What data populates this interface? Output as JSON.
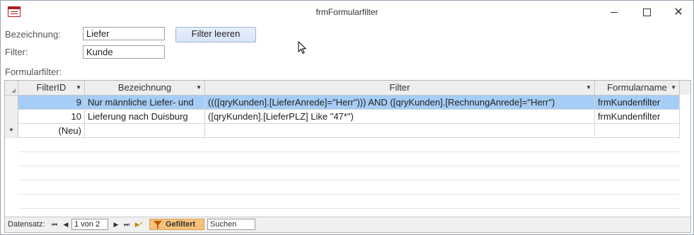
{
  "window": {
    "title": "frmFormularfilter"
  },
  "form": {
    "bezeichnung_label": "Bezeichnung:",
    "bezeichnung_value": "Liefer",
    "filter_label": "Filter:",
    "filter_value": "Kunde",
    "clear_button": "Filter leeren",
    "subform_label": "Formularfilter:"
  },
  "grid": {
    "columns": [
      "FilterID",
      "Bezeichnung",
      "Filter",
      "Formularname"
    ],
    "rows": [
      {
        "id": "9",
        "bezeichnung": "Nur männliche Liefer- und",
        "filter": "((([qryKunden].[LieferAnrede]=\"Herr\"))) AND ([qryKunden].[RechnungAnrede]=\"Herr\")",
        "formularname": "frmKundenfilter"
      },
      {
        "id": "10",
        "bezeichnung": "Lieferung nach Duisburg",
        "filter": "([qryKunden].[LieferPLZ] Like \"47*\")",
        "formularname": "frmKundenfilter"
      }
    ],
    "new_row_marker": "*",
    "new_row_label": "(Neu)"
  },
  "navbar": {
    "label": "Datensatz:",
    "record": "1 von 2",
    "filtered": "Gefiltert",
    "search": "Suchen"
  }
}
